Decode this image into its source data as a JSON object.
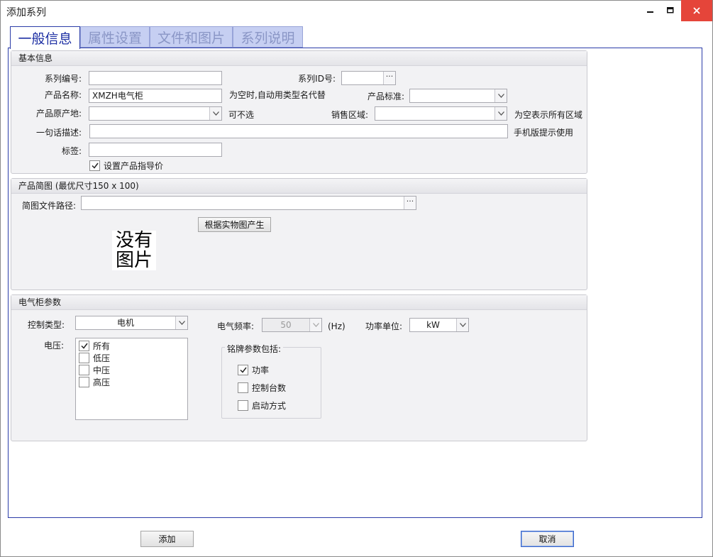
{
  "window": {
    "title": "添加系列"
  },
  "tabs": [
    {
      "label": "一般信息"
    },
    {
      "label": "属性设置"
    },
    {
      "label": "文件和图片"
    },
    {
      "label": "系列说明"
    }
  ],
  "basic": {
    "heading": "基本信息",
    "series_no_label": "系列编号:",
    "series_no_value": "",
    "series_id_label": "系列ID号:",
    "series_id_value": "",
    "product_name_label": "产品名称:",
    "product_name_value": "XMZH电气柜",
    "product_name_hint": "为空时,自动用类型名代替",
    "product_standard_label": "产品标准:",
    "product_standard_value": "",
    "origin_label": "产品原产地:",
    "origin_value": "",
    "origin_hint": "可不选",
    "sales_region_label": "销售区域:",
    "sales_region_value": "",
    "sales_region_hint": "为空表示所有区域",
    "one_line_label": "一句话描述:",
    "one_line_value": "",
    "one_line_hint": "手机版提示使用",
    "tags_label": "标签:",
    "tags_value": "",
    "guide_price_label": "设置产品指导价",
    "guide_price_checked": true
  },
  "sketch": {
    "heading": "产品简图 (最优尺寸150 x 100)",
    "path_label": "简图文件路径:",
    "path_value": "",
    "generate_button": "根据实物图产生",
    "no_image_line1": "没有",
    "no_image_line2": "图片"
  },
  "cabinet": {
    "heading": "电气柜参数",
    "control_type_label": "控制类型:",
    "control_type_value": "电机",
    "frequency_label": "电气频率:",
    "frequency_value": "50",
    "frequency_unit": "(Hz)",
    "power_unit_label": "功率单位:",
    "power_unit_value": "kW",
    "voltage_label": "电压:",
    "voltage_options": [
      {
        "label": "所有",
        "checked": true
      },
      {
        "label": "低压",
        "checked": false
      },
      {
        "label": "中压",
        "checked": false
      },
      {
        "label": "高压",
        "checked": false
      }
    ],
    "nameplate_label": "铭牌参数包括:",
    "nameplate_options": [
      {
        "label": "功率",
        "checked": true
      },
      {
        "label": "控制台数",
        "checked": false
      },
      {
        "label": "启动方式",
        "checked": false
      }
    ]
  },
  "footer": {
    "add_button": "添加",
    "cancel_button": "取消"
  }
}
